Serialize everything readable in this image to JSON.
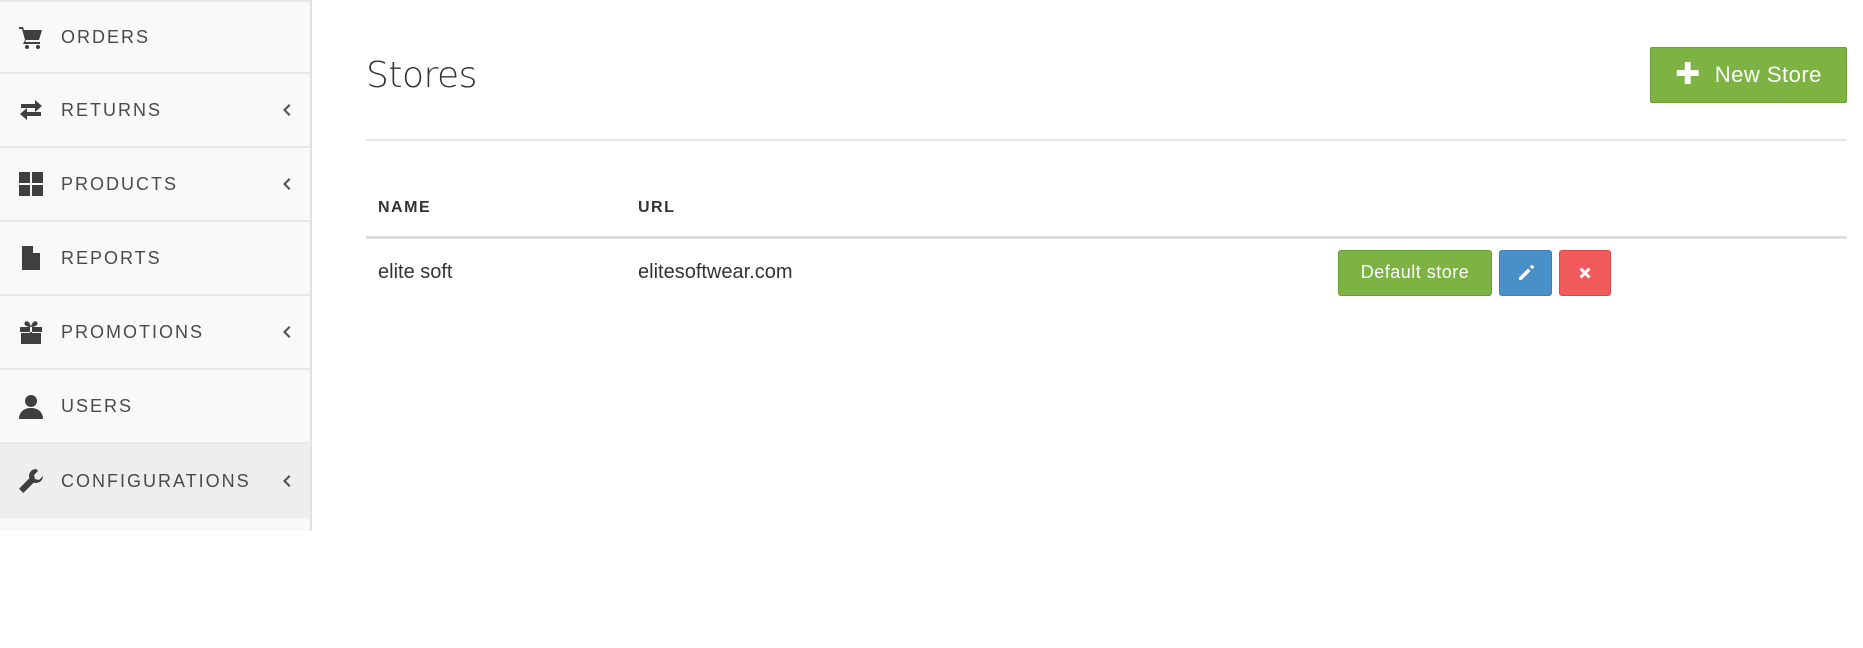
{
  "sidebar": {
    "items": [
      {
        "label": "ORDERS",
        "icon": "cart-icon",
        "has_submenu": false
      },
      {
        "label": "RETURNS",
        "icon": "exchange-icon",
        "has_submenu": true
      },
      {
        "label": "PRODUCTS",
        "icon": "grid-icon",
        "has_submenu": true
      },
      {
        "label": "REPORTS",
        "icon": "file-icon",
        "has_submenu": false
      },
      {
        "label": "PROMOTIONS",
        "icon": "gift-icon",
        "has_submenu": true
      },
      {
        "label": "USERS",
        "icon": "user-icon",
        "has_submenu": false
      },
      {
        "label": "CONFIGURATIONS",
        "icon": "wrench-icon",
        "has_submenu": true,
        "active": true
      }
    ]
  },
  "page": {
    "title": "Stores",
    "new_store_label": "New Store"
  },
  "table": {
    "headers": {
      "name": "NAME",
      "url": "URL"
    },
    "rows": [
      {
        "name": "elite soft",
        "url": "elitesoftwear.com",
        "default_label": "Default store"
      }
    ]
  },
  "colors": {
    "green": "#7cb342",
    "blue": "#4a90c8",
    "red": "#f15a5a"
  }
}
